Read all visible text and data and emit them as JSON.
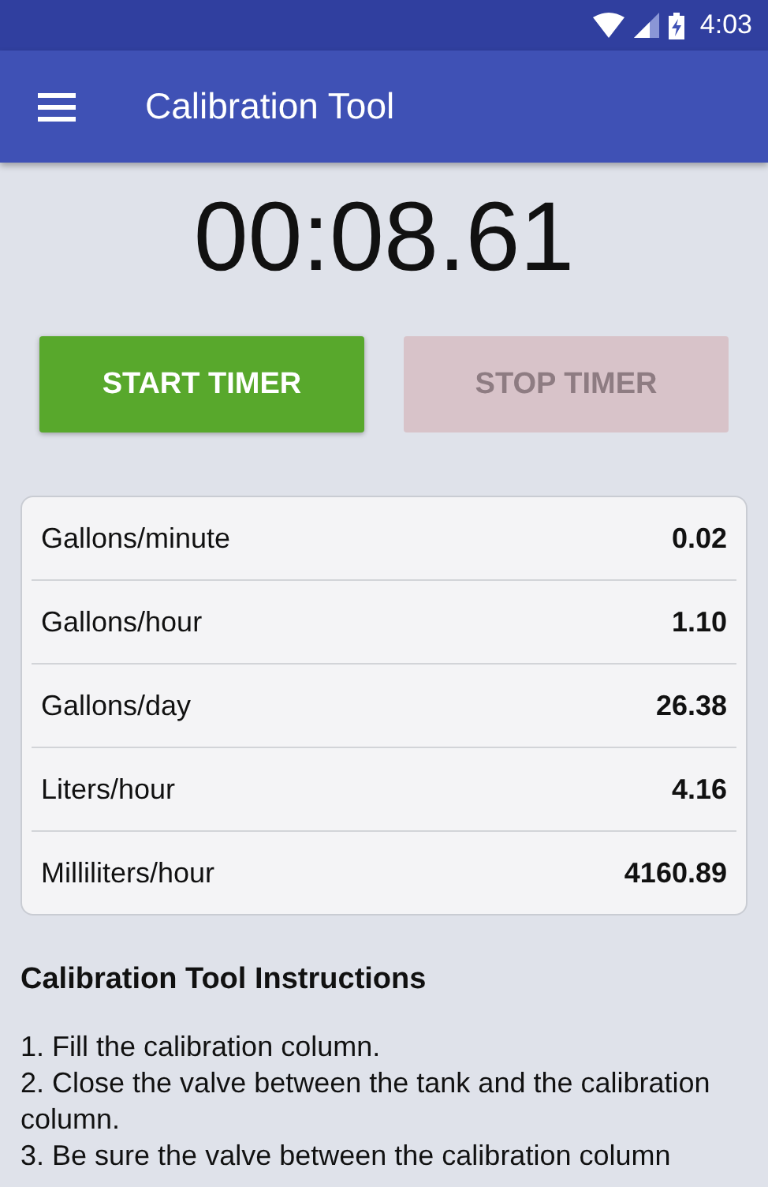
{
  "status_bar": {
    "time": "4:03"
  },
  "app_bar": {
    "title": "Calibration Tool"
  },
  "timer": {
    "reading": "00:08.61"
  },
  "buttons": [
    {
      "label": "START TIMER",
      "disabled": false
    },
    {
      "label": "STOP TIMER",
      "disabled": true
    }
  ],
  "rates": [
    {
      "label": "Gallons/minute",
      "value": "0.02"
    },
    {
      "label": "Gallons/hour",
      "value": "1.10"
    },
    {
      "label": "Gallons/day",
      "value": "26.38"
    },
    {
      "label": "Liters/hour",
      "value": "4.16"
    },
    {
      "label": "Milliliters/hour",
      "value": "4160.89"
    }
  ],
  "instructions": {
    "title": "Calibration Tool Instructions",
    "steps": [
      "1. Fill the calibration column.",
      "2. Close the valve between the tank and the calibration column.",
      "3. Be sure the valve between the calibration column"
    ]
  }
}
